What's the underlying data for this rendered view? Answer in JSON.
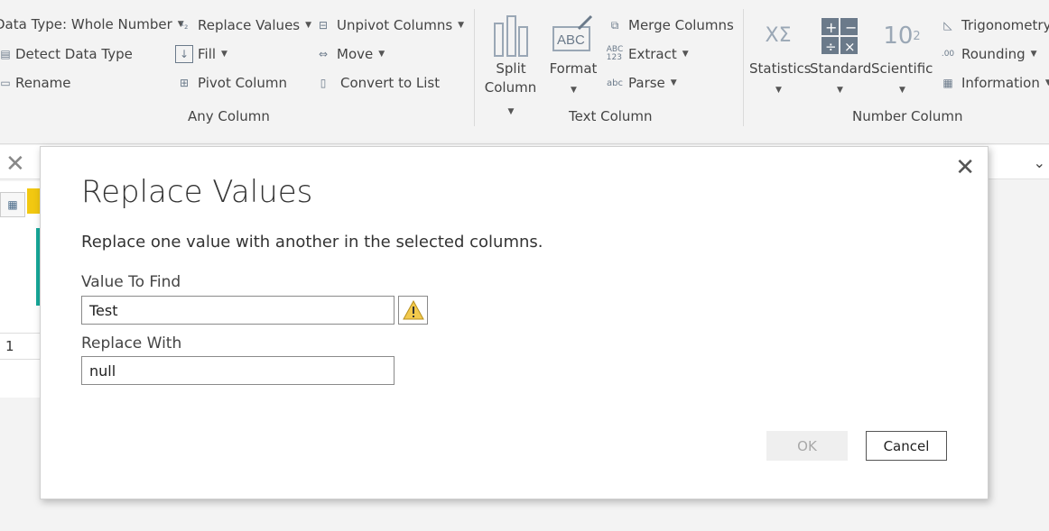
{
  "ribbon": {
    "any_column": {
      "group_label": "Any Column",
      "data_type": "Data Type: Whole Number",
      "detect_data_type": "Detect Data Type",
      "rename": "Rename",
      "replace_values": "Replace Values",
      "fill": "Fill",
      "pivot_column": "Pivot Column",
      "unpivot_columns": "Unpivot Columns",
      "move": "Move",
      "convert_to_list": "Convert to List"
    },
    "text_column": {
      "group_label": "Text Column",
      "split_column_1": "Split",
      "split_column_2": "Column",
      "format": "Format",
      "merge_columns": "Merge Columns",
      "extract": "Extract",
      "parse": "Parse"
    },
    "number_column": {
      "group_label": "Number Column",
      "statistics": "Statistics",
      "standard": "Standard",
      "scientific": "Scientific",
      "trigonometry": "Trigonometry",
      "rounding": "Rounding",
      "information": "Information"
    }
  },
  "grid": {
    "row_number": "1"
  },
  "dialog": {
    "title": "Replace Values",
    "description": "Replace one value with another in the selected columns.",
    "value_to_find_label": "Value To Find",
    "value_to_find": "Test",
    "replace_with_label": "Replace With",
    "replace_with": "null",
    "ok_label": "OK",
    "cancel_label": "Cancel"
  },
  "colors": {
    "warning": "#f2c94c",
    "accent_teal": "#16a99a",
    "header_yellow": "#f2c811"
  }
}
